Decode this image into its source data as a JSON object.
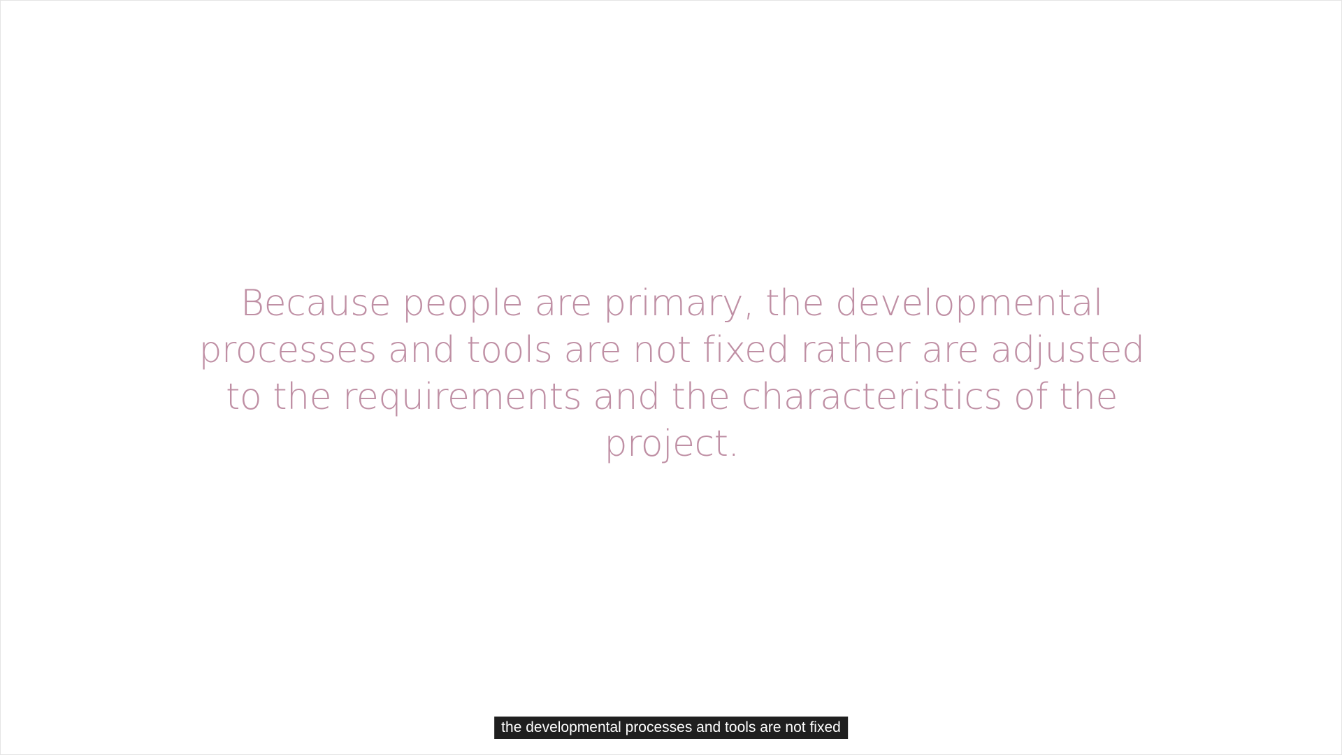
{
  "slide": {
    "quote": "Because people are primary, the developmental processes and tools are not fixed rather are adjusted to the requirements and the characteristics of the project.",
    "text_color": "#bf8fa4",
    "background_color": "#ffffff"
  },
  "subtitle": {
    "text": "the developmental processes and tools are not fixed",
    "background_color": "#1f1f1f",
    "text_color": "#ffffff"
  }
}
